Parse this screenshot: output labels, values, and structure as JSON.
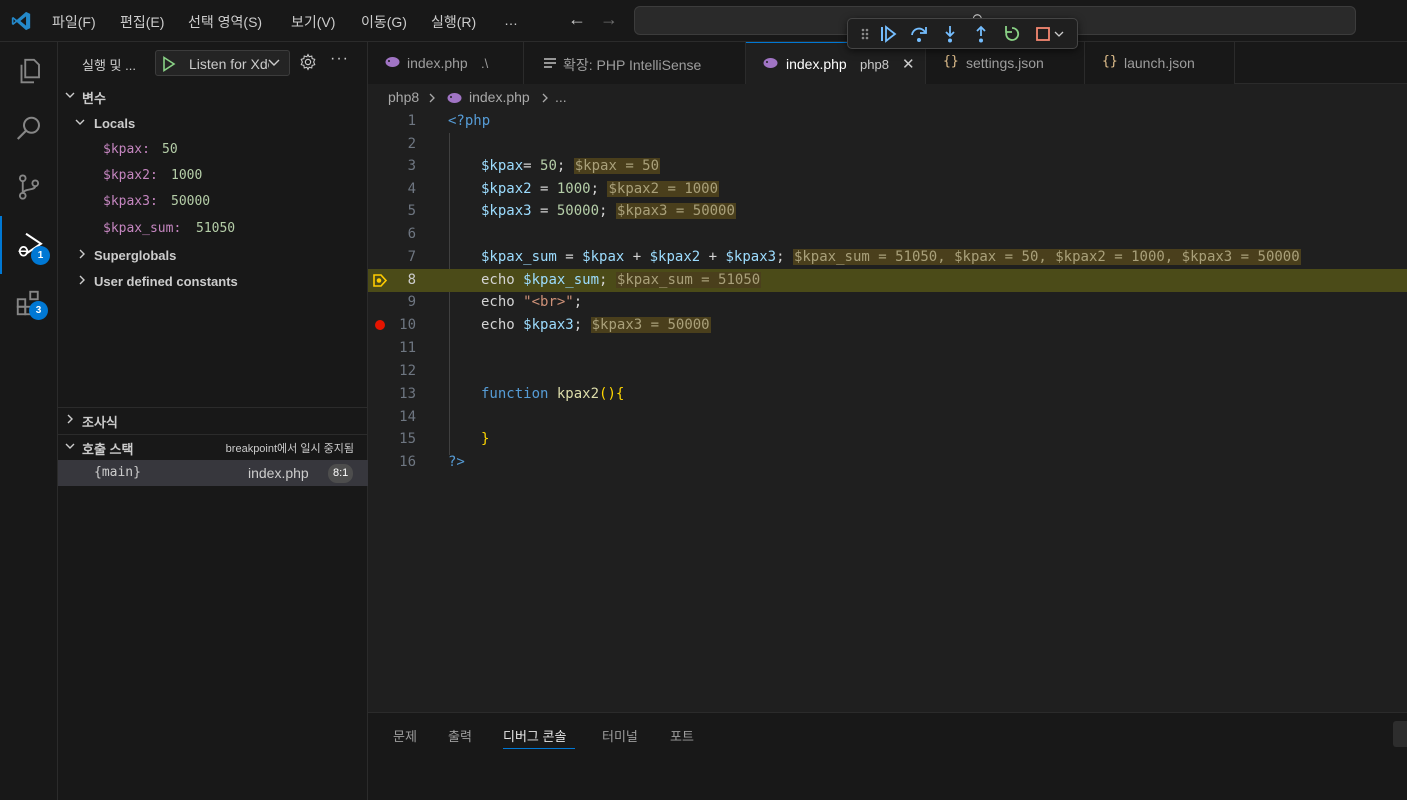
{
  "menu": [
    "파일(F)",
    "편집(E)",
    "선택 영역(S)",
    "보기(V)",
    "이동(G)",
    "실행(R)",
    "…"
  ],
  "sidebar": {
    "title": "실행 및 ...",
    "launch_config": "Listen for Xdebug",
    "more": "···",
    "variables": {
      "header": "변수",
      "locals_header": "Locals",
      "locals": [
        {
          "name": "$kpax:",
          "value": "50"
        },
        {
          "name": "$kpax2:",
          "value": "1000"
        },
        {
          "name": "$kpax3:",
          "value": "50000"
        },
        {
          "name": "$kpax_sum:",
          "value": "51050"
        }
      ],
      "superglobals": "Superglobals",
      "user_constants": "User defined constants"
    },
    "watch": {
      "header": "조사식"
    },
    "callstack": {
      "header": "호출 스택",
      "status": "breakpoint에서 일시 중지됨",
      "frame": {
        "name": "{main}",
        "file": "index.php",
        "pos": "8:1"
      }
    }
  },
  "activity": {
    "debug_badge": "1",
    "extensions_badge": "3"
  },
  "tabs": [
    {
      "label": "index.php",
      "desc": ".\\"
    },
    {
      "label": "확장: PHP IntelliSense",
      "desc": ""
    },
    {
      "label": "index.php",
      "desc": "php8",
      "close": "✕"
    },
    {
      "label": "settings.json",
      "desc": ""
    },
    {
      "label": "launch.json",
      "desc": ""
    }
  ],
  "breadcrumb": {
    "folder": "php8",
    "file": "index.php",
    "more": "..."
  },
  "editor": {
    "lines": [
      {
        "n": "1"
      },
      {
        "n": "2"
      },
      {
        "n": "3"
      },
      {
        "n": "4"
      },
      {
        "n": "5"
      },
      {
        "n": "6"
      },
      {
        "n": "7"
      },
      {
        "n": "8"
      },
      {
        "n": "9"
      },
      {
        "n": "10"
      },
      {
        "n": "11"
      },
      {
        "n": "12"
      },
      {
        "n": "13"
      },
      {
        "n": "14"
      },
      {
        "n": "15"
      },
      {
        "n": "16"
      }
    ],
    "code": {
      "open_tag": "<?php",
      "l3_var": "$kpax",
      "l3_op": "= ",
      "l3_num": "50",
      "l3_end": ";",
      "l3_inline": "$kpax = 50",
      "l4_var": "$kpax2",
      "l4_op": " = ",
      "l4_num": "1000",
      "l4_end": ";",
      "l4_inline": "$kpax2 = 1000",
      "l5_var": "$kpax3",
      "l5_op": " = ",
      "l5_num": "50000",
      "l5_end": ";",
      "l5_inline": "$kpax3 = 50000",
      "l7_a": "$kpax_sum",
      "l7_eq": " = ",
      "l7_b": "$kpax",
      "l7_p1": " + ",
      "l7_c": "$kpax2",
      "l7_p2": " + ",
      "l7_d": "$kpax3",
      "l7_end": ";",
      "l7_inline": "$kpax_sum = 51050, $kpax = 50, $kpax2 = 1000, $kpax3 = 50000",
      "l8_echo": "echo ",
      "l8_var": "$kpax_sum",
      "l8_end": ";",
      "l8_inline": "$kpax_sum = 51050",
      "l9_echo": "echo ",
      "l9_str": "\"<br>\"",
      "l9_end": ";",
      "l10_echo": "echo ",
      "l10_var": "$kpax3",
      "l10_end": ";",
      "l10_inline": "$kpax3 = 50000",
      "l13_kw": "function ",
      "l13_fn": "kpax2",
      "l13_br": "(){",
      "l15_br": "}",
      "close_tag": "?>"
    }
  },
  "panel": {
    "tabs": [
      "문제",
      "출력",
      "디버그 콘솔",
      "터미널",
      "포트"
    ]
  }
}
